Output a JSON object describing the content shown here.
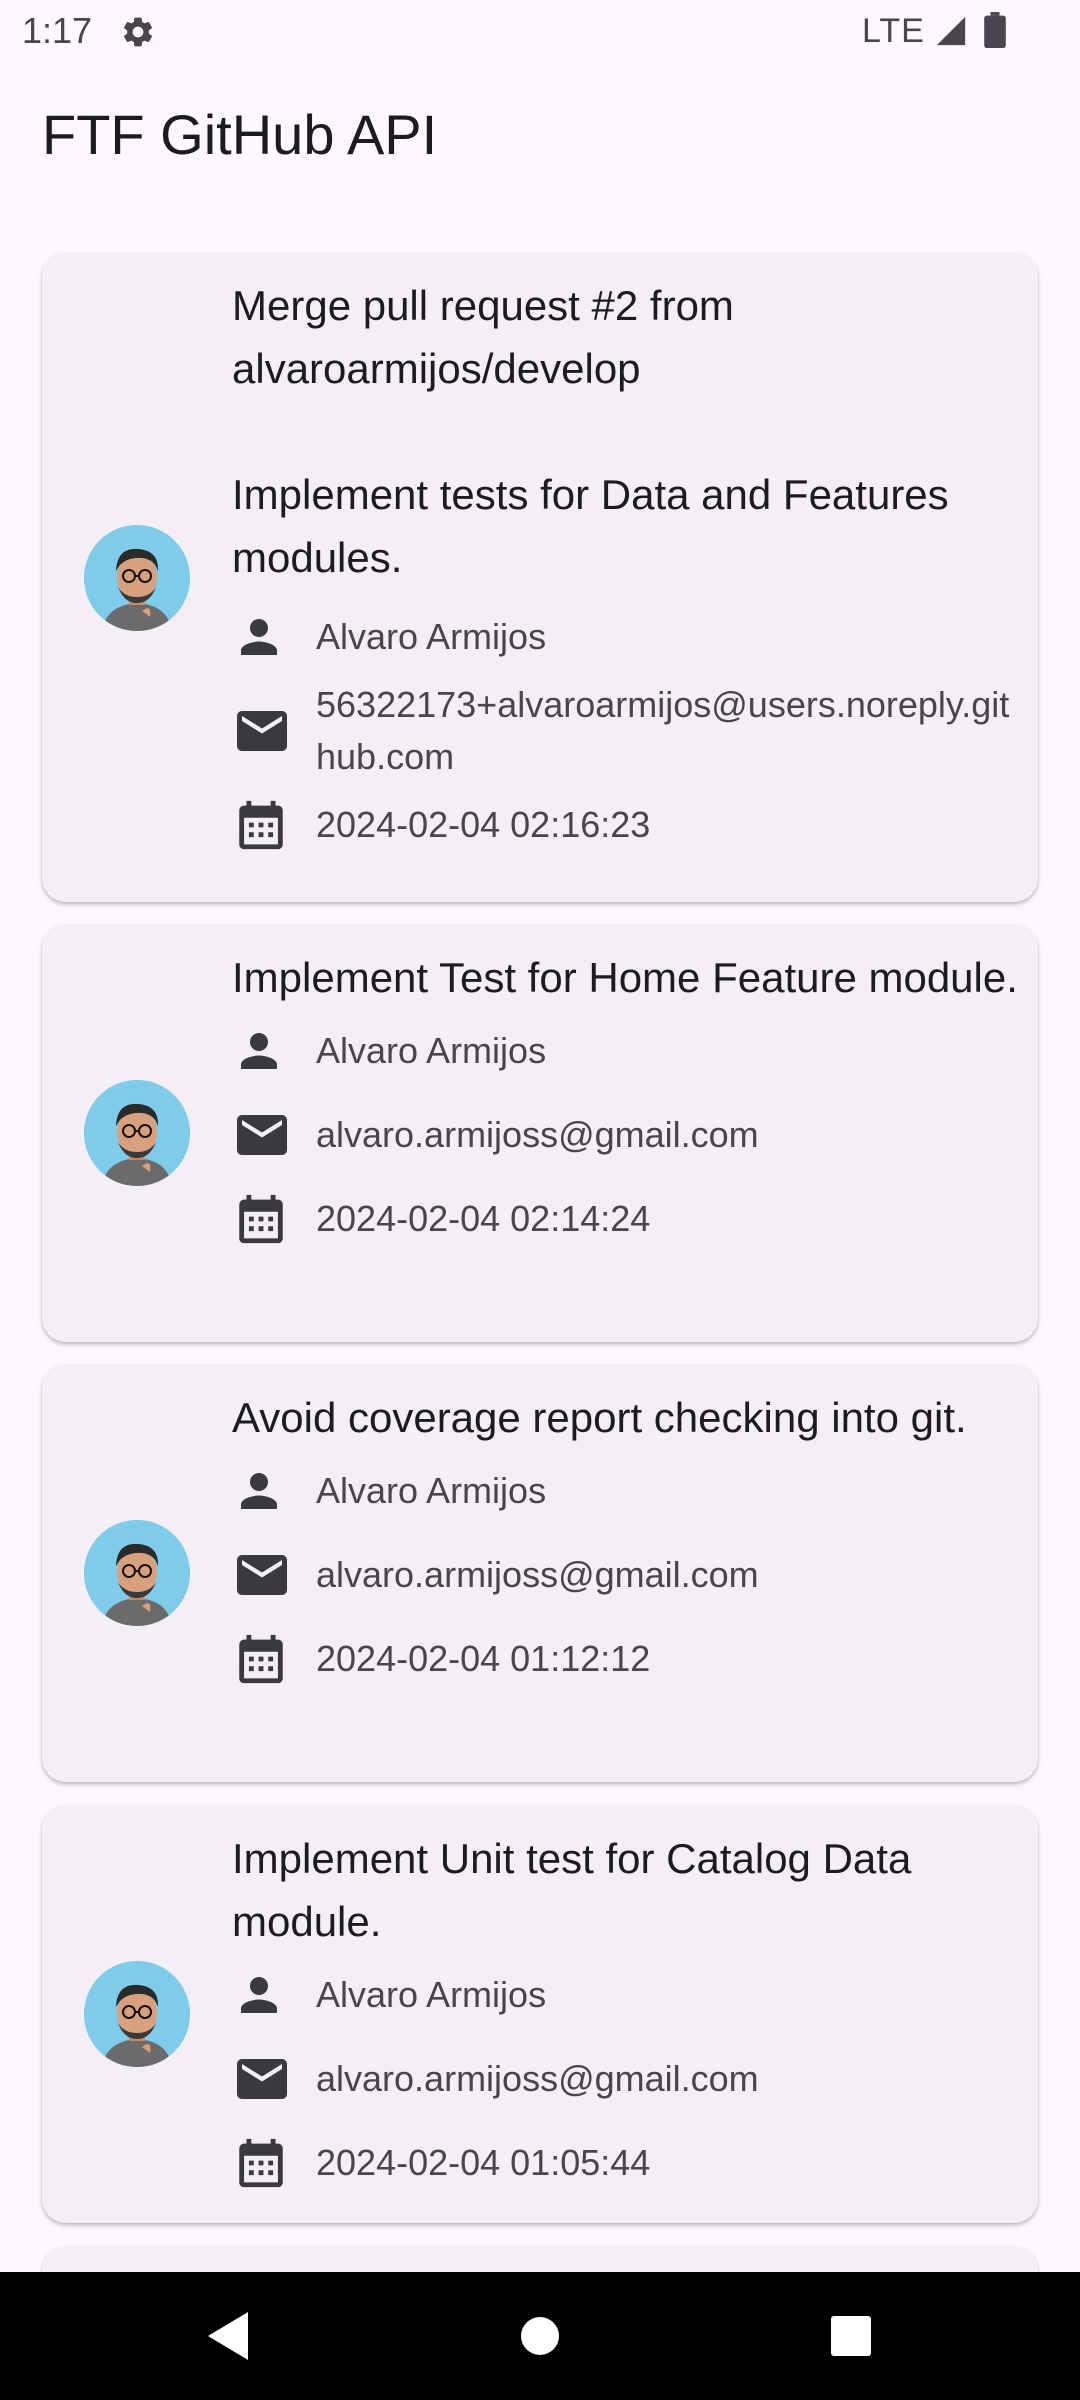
{
  "status_bar": {
    "time": "1:17",
    "network": "LTE",
    "icons": [
      "gear-icon",
      "signal-icon",
      "battery-icon"
    ]
  },
  "app_bar": {
    "title": "FTF GitHub API"
  },
  "commits": [
    {
      "message": "Merge pull request #2 from alvaroarmijos/develop\n\nImplement tests for Data and Features modules.",
      "author": "Alvaro Armijos",
      "email": "56322173+alvaroarmijos@users.noreply.github.com",
      "date": "2024-02-04 02:16:23"
    },
    {
      "message": "Implement Test for Home Feature module.",
      "author": "Alvaro Armijos",
      "email": "alvaro.armijoss@gmail.com",
      "date": "2024-02-04 02:14:24"
    },
    {
      "message": "Avoid coverage report checking into git.",
      "author": "Alvaro Armijos",
      "email": "alvaro.armijoss@gmail.com",
      "date": "2024-02-04 01:12:12"
    },
    {
      "message": "Implement Unit test for Catalog Data module.",
      "author": "Alvaro Armijos",
      "email": "alvaro.armijoss@gmail.com",
      "date": "2024-02-04 01:05:44"
    }
  ],
  "icons": {
    "author": "person-icon",
    "email": "mail-icon",
    "date": "calendar-icon"
  },
  "colors": {
    "background": "#FDF8FD",
    "card": "#F4EFF4",
    "text_primary": "#1C1B1F",
    "text_secondary": "#49454F",
    "avatar_bg": "#7FCBEA",
    "nav_bar": "#000000"
  },
  "nav_bar": {
    "buttons": [
      "back-icon",
      "home-icon",
      "recents-icon"
    ]
  }
}
